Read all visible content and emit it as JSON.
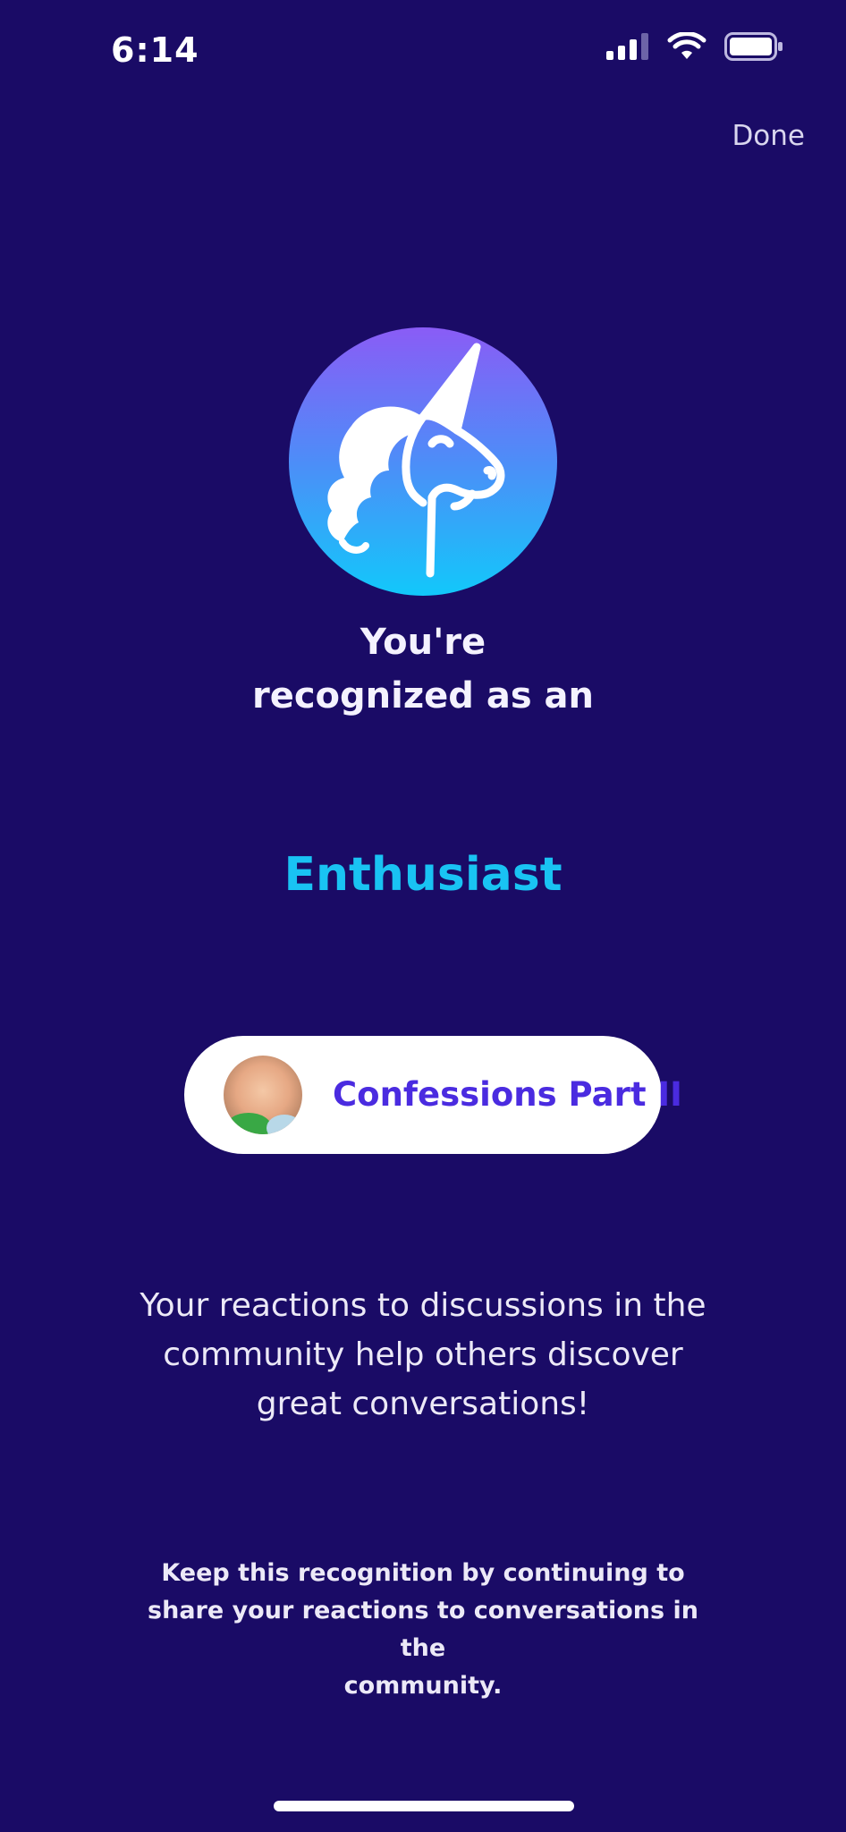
{
  "status_bar": {
    "time": "6:14",
    "icons": [
      "cellular-signal-icon",
      "wifi-icon",
      "battery-icon"
    ]
  },
  "header": {
    "done_label": "Done"
  },
  "badge": {
    "icon": "unicorn-icon",
    "gradient_colors": [
      "#8a5cf6",
      "#4d8df8",
      "#12c8fa"
    ]
  },
  "recognition": {
    "line1": "You're",
    "line2": "recognized as an",
    "title": "Enthusiast"
  },
  "conversation_pill": {
    "label": "Confessions Part II",
    "avatar": "user-avatar"
  },
  "description": {
    "line1": "Your reactions to discussions in the",
    "line2": "community help others discover",
    "line3": "great conversations!"
  },
  "footnote": {
    "line1": "Keep this recognition by continuing to",
    "line2": "share your reactions to conversations in the",
    "line3": "community."
  },
  "colors": {
    "background": "#1a0b66",
    "accent": "#19c3f3",
    "pill_text": "#4a2be0"
  }
}
